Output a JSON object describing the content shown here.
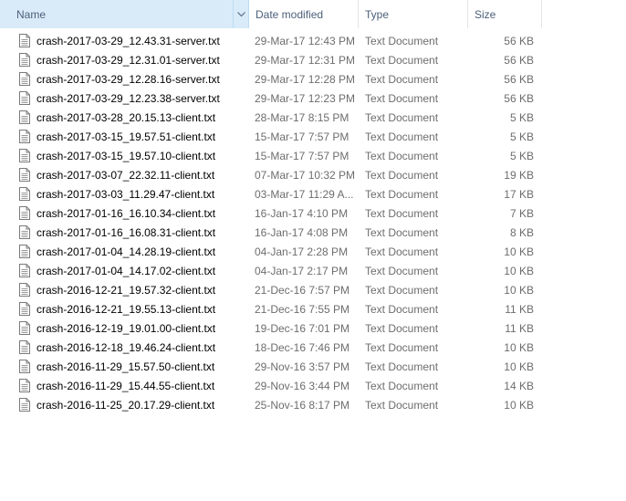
{
  "columns": {
    "name": "Name",
    "date": "Date modified",
    "type": "Type",
    "size": "Size"
  },
  "sort_column": "name",
  "sort_icon": "chevron-down-icon",
  "file_icon": "text-document-icon",
  "files": [
    {
      "name": "crash-2017-03-29_12.43.31-server.txt",
      "date": "29-Mar-17 12:43 PM",
      "type": "Text Document",
      "size": "56 KB"
    },
    {
      "name": "crash-2017-03-29_12.31.01-server.txt",
      "date": "29-Mar-17 12:31 PM",
      "type": "Text Document",
      "size": "56 KB"
    },
    {
      "name": "crash-2017-03-29_12.28.16-server.txt",
      "date": "29-Mar-17 12:28 PM",
      "type": "Text Document",
      "size": "56 KB"
    },
    {
      "name": "crash-2017-03-29_12.23.38-server.txt",
      "date": "29-Mar-17 12:23 PM",
      "type": "Text Document",
      "size": "56 KB"
    },
    {
      "name": "crash-2017-03-28_20.15.13-client.txt",
      "date": "28-Mar-17 8:15 PM",
      "type": "Text Document",
      "size": "5 KB"
    },
    {
      "name": "crash-2017-03-15_19.57.51-client.txt",
      "date": "15-Mar-17 7:57 PM",
      "type": "Text Document",
      "size": "5 KB"
    },
    {
      "name": "crash-2017-03-15_19.57.10-client.txt",
      "date": "15-Mar-17 7:57 PM",
      "type": "Text Document",
      "size": "5 KB"
    },
    {
      "name": "crash-2017-03-07_22.32.11-client.txt",
      "date": "07-Mar-17 10:32 PM",
      "type": "Text Document",
      "size": "19 KB"
    },
    {
      "name": "crash-2017-03-03_11.29.47-client.txt",
      "date": "03-Mar-17 11:29 A...",
      "type": "Text Document",
      "size": "17 KB"
    },
    {
      "name": "crash-2017-01-16_16.10.34-client.txt",
      "date": "16-Jan-17 4:10 PM",
      "type": "Text Document",
      "size": "7 KB"
    },
    {
      "name": "crash-2017-01-16_16.08.31-client.txt",
      "date": "16-Jan-17 4:08 PM",
      "type": "Text Document",
      "size": "8 KB"
    },
    {
      "name": "crash-2017-01-04_14.28.19-client.txt",
      "date": "04-Jan-17 2:28 PM",
      "type": "Text Document",
      "size": "10 KB"
    },
    {
      "name": "crash-2017-01-04_14.17.02-client.txt",
      "date": "04-Jan-17 2:17 PM",
      "type": "Text Document",
      "size": "10 KB"
    },
    {
      "name": "crash-2016-12-21_19.57.32-client.txt",
      "date": "21-Dec-16 7:57 PM",
      "type": "Text Document",
      "size": "10 KB"
    },
    {
      "name": "crash-2016-12-21_19.55.13-client.txt",
      "date": "21-Dec-16 7:55 PM",
      "type": "Text Document",
      "size": "11 KB"
    },
    {
      "name": "crash-2016-12-19_19.01.00-client.txt",
      "date": "19-Dec-16 7:01 PM",
      "type": "Text Document",
      "size": "11 KB"
    },
    {
      "name": "crash-2016-12-18_19.46.24-client.txt",
      "date": "18-Dec-16 7:46 PM",
      "type": "Text Document",
      "size": "10 KB"
    },
    {
      "name": "crash-2016-11-29_15.57.50-client.txt",
      "date": "29-Nov-16 3:57 PM",
      "type": "Text Document",
      "size": "10 KB"
    },
    {
      "name": "crash-2016-11-29_15.44.55-client.txt",
      "date": "29-Nov-16 3:44 PM",
      "type": "Text Document",
      "size": "14 KB"
    },
    {
      "name": "crash-2016-11-25_20.17.29-client.txt",
      "date": "25-Nov-16 8:17 PM",
      "type": "Text Document",
      "size": "10 KB"
    }
  ]
}
